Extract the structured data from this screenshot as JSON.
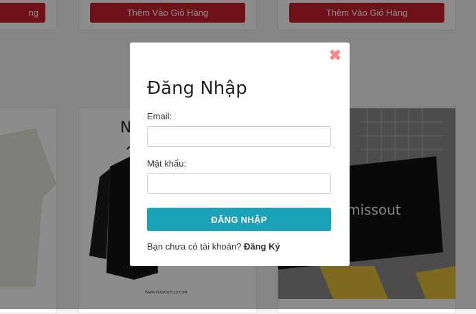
{
  "background": {
    "cart_button_label": "Thêm Vào Giỏ Hàng",
    "bag_brand": "missout",
    "product_caption": "WWW.MISSOUTCLO.COM"
  },
  "modal": {
    "close_symbol": "✖",
    "title": "Đăng Nhập",
    "email_label": "Email:",
    "email_value": "",
    "password_label": "Mật khẩu:",
    "password_value": "",
    "submit_label": "ĐĂNG NHẬP",
    "no_account_text": "Bạn chưa có tài khoản?",
    "register_link": "Đăng Ký"
  },
  "colors": {
    "accent": "#1aa2b8",
    "cart_button": "#c8202e",
    "close": "#f08a8a"
  }
}
